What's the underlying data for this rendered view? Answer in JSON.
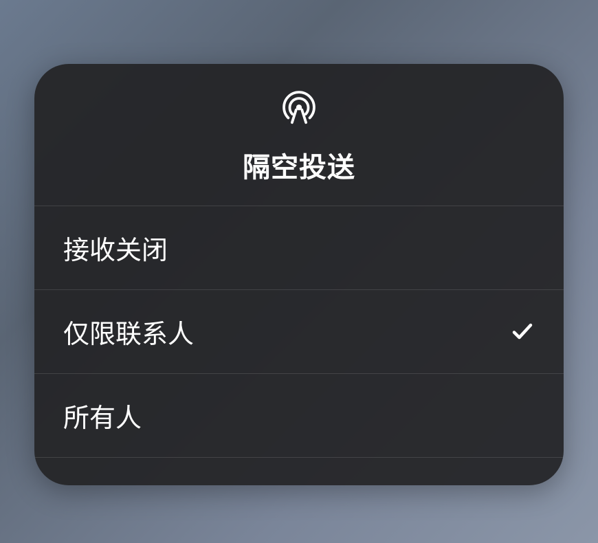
{
  "panel": {
    "title": "隔空投送",
    "icon": "airdrop-icon",
    "options": [
      {
        "label": "接收关闭",
        "selected": false
      },
      {
        "label": "仅限联系人",
        "selected": true
      },
      {
        "label": "所有人",
        "selected": false
      }
    ]
  }
}
